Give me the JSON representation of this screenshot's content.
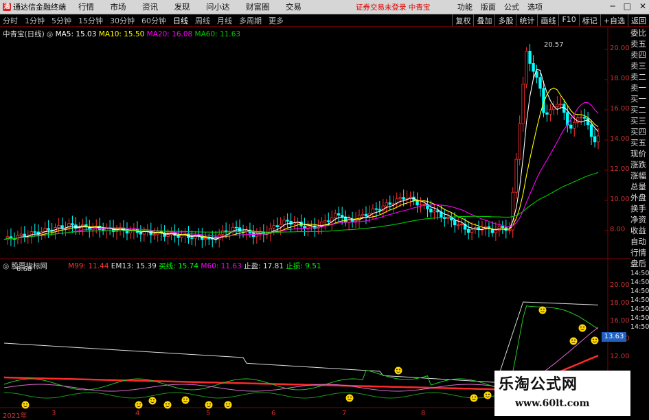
{
  "titlebar": {
    "app_name": "通达信金融终端",
    "menu": [
      "行情",
      "市场",
      "资讯",
      "发现",
      "问小达",
      "财富圈",
      "交易"
    ],
    "notice": "证券交易未登录  中青宝",
    "right_menu": [
      "功能",
      "版面",
      "公式",
      "选项"
    ]
  },
  "periods": [
    "分时",
    "1分钟",
    "5分钟",
    "15分钟",
    "30分钟",
    "60分钟",
    "日线",
    "周线",
    "月线",
    "多周期",
    "更多"
  ],
  "active_period": "日线",
  "toolbar": [
    "复权",
    "叠加",
    "多股",
    "统计",
    "画线",
    "F10",
    "标记",
    "+自选",
    "返回"
  ],
  "main_legend": {
    "stock": "中青宝(日线)",
    "ma5": "MA5: 15.03",
    "ma10": "MA10: 15.50",
    "ma20": "MA20: 16.08",
    "ma60": "MA60: 11.63"
  },
  "indicator_legend": {
    "name": "股票指标网",
    "m99": "M99: 11.44",
    "em13": "EM13: 15.39",
    "buy": "买线: 15.74",
    "m60": "M60: 11.63",
    "stop_gain": "止盈: 17.81",
    "stop_loss": "止损: 9.51"
  },
  "price_axis": [
    "20.00",
    "18.00",
    "16.00",
    "14.00",
    "12.00",
    "10.00",
    "8.00"
  ],
  "high_label": "20.57",
  "low_label": "6.68",
  "lower_axis": [
    "20.00",
    "18.00",
    "16.00",
    "14.00",
    "12.00"
  ],
  "lower_value_box": "13.63",
  "dates": [
    "2021年",
    "3",
    "4",
    "5",
    "6",
    "7",
    "8"
  ],
  "right_panel": [
    "委比",
    "卖五",
    "卖四",
    "卖三",
    "卖二",
    "卖一",
    "买一",
    "买二",
    "买三",
    "买四",
    "买五",
    "现价",
    "涨跌",
    "涨幅",
    "总量",
    "外盘",
    "换手",
    "净资",
    "收益",
    "自动",
    "行情",
    "盘后",
    "14:50",
    "14:50",
    "14:50",
    "14:50",
    "14:50",
    "14:50",
    "14:50"
  ],
  "watermark": {
    "title": "乐淘公式网",
    "url": "www.60lt.com"
  },
  "colors": {
    "ma5": "#ffffff",
    "ma10": "#ffff00",
    "ma20": "#ff00ff",
    "ma60": "#00cc00",
    "up": "#ff3333",
    "down": "#00ffff"
  }
}
